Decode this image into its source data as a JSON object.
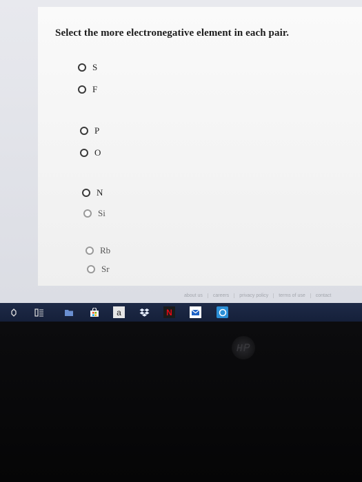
{
  "question": "Select the more electronegative element in each pair.",
  "pairs": [
    {
      "options": [
        "S",
        "F"
      ]
    },
    {
      "options": [
        "P",
        "O"
      ]
    },
    {
      "options": [
        "N",
        "Si"
      ]
    },
    {
      "options": [
        "Rb",
        "Sr"
      ]
    }
  ],
  "footer_links": [
    "about us",
    "careers",
    "privacy policy",
    "terms of use",
    "contact"
  ],
  "taskbar_icons": [
    "notification-icon",
    "task-view-icon",
    "file-explorer-icon",
    "store-icon",
    "amazon-icon",
    "dropbox-icon",
    "netflix-icon",
    "mail-icon",
    "edge-icon"
  ],
  "taskbar_glyphs": {
    "amazon": "a",
    "netflix": "N"
  },
  "colors": {
    "taskbar": "#1e2a47",
    "page": "#fafafa",
    "netflix": "#e50914",
    "dropbox": "#2a7fff",
    "edge": "#2b8fd6"
  }
}
